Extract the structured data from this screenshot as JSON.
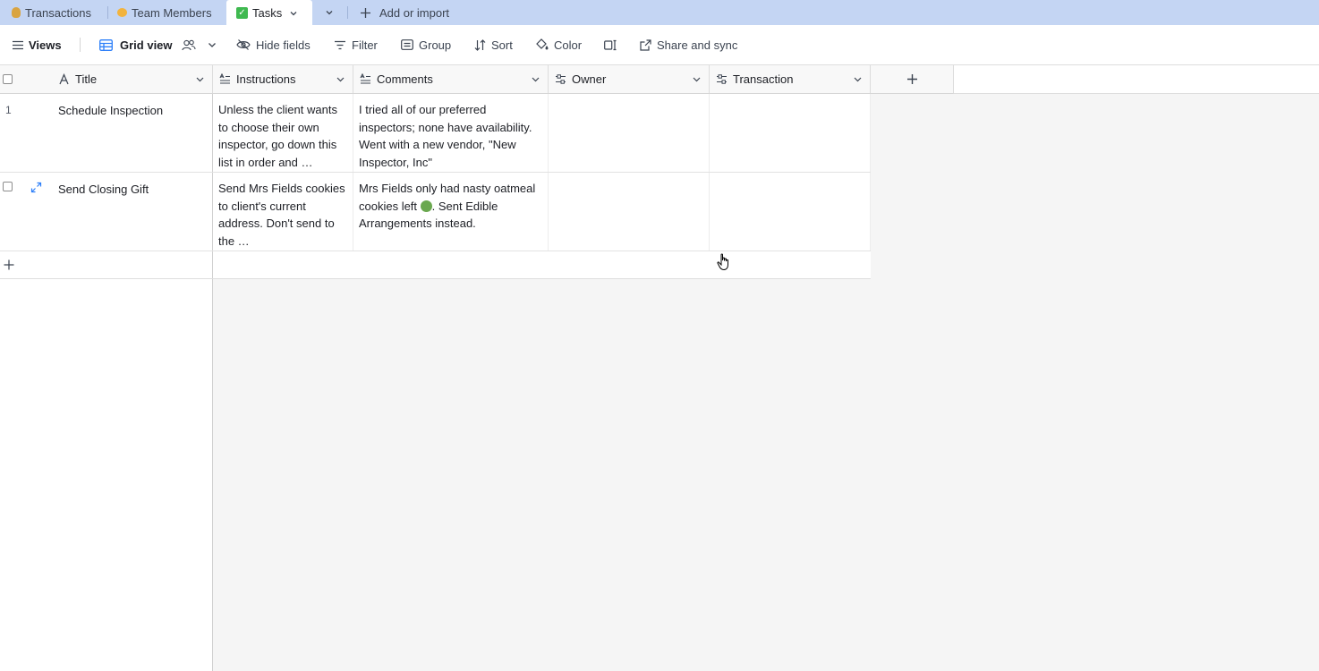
{
  "tabs": [
    {
      "label": "Transactions",
      "icon": "money-bag-icon",
      "active": false
    },
    {
      "label": "Team Members",
      "icon": "cat-face-icon",
      "active": false
    },
    {
      "label": "Tasks",
      "icon": "check-mark-icon",
      "active": true
    }
  ],
  "tabbar": {
    "add_label": "Add or import"
  },
  "toolbar": {
    "views_label": "Views",
    "grid_view_label": "Grid view",
    "hide_fields_label": "Hide fields",
    "filter_label": "Filter",
    "group_label": "Group",
    "sort_label": "Sort",
    "color_label": "Color",
    "share_label": "Share and sync"
  },
  "columns": [
    {
      "label": "Title",
      "icon": "text-field-icon"
    },
    {
      "label": "Instructions",
      "icon": "long-text-icon"
    },
    {
      "label": "Comments",
      "icon": "long-text-icon"
    },
    {
      "label": "Owner",
      "icon": "link-field-icon"
    },
    {
      "label": "Transaction",
      "icon": "link-field-icon"
    }
  ],
  "rows": [
    {
      "number": "1",
      "title": "Schedule Inspection",
      "instructions": "Unless the client wants to choose their own inspector, go down this list in order and …",
      "comments": "I tried all of our preferred inspectors; none have availability. Went with a new vendor, \"New Inspector, Inc\"",
      "owner": "",
      "transaction": ""
    },
    {
      "number": "",
      "title": "Send Closing Gift",
      "instructions": "Send Mrs Fields cookies to client's current address. Don't send to the …",
      "comments_before": "Mrs Fields only had nasty oatmeal cookies left ",
      "comments_emoji": "nauseated-face-icon",
      "comments_after": ". Sent Edible Arrangements instead.",
      "owner": "",
      "transaction": ""
    }
  ],
  "colors": {
    "tabbar_bg": "#c4d5f3",
    "grid_accent": "#2d7ff9",
    "canvas_bg": "#f5f5f5"
  }
}
